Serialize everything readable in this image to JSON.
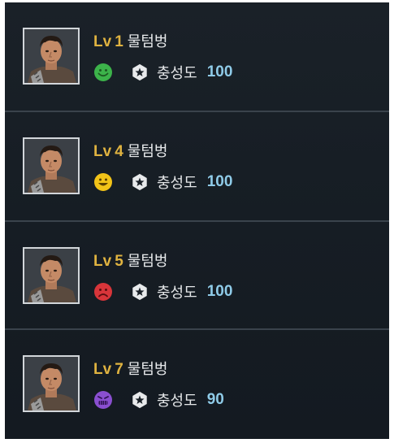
{
  "units": [
    {
      "lv_label": "Lv",
      "level": "1",
      "name": "물텀벙",
      "mood": "green-smile-icon",
      "mood_color": "#3cb34a",
      "loyalty_label": "충성도",
      "loyalty_value": "100"
    },
    {
      "lv_label": "Lv",
      "level": "4",
      "name": "물텀벙",
      "mood": "yellow-grin-icon",
      "mood_color": "#f2c318",
      "loyalty_label": "충성도",
      "loyalty_value": "100"
    },
    {
      "lv_label": "Lv",
      "level": "5",
      "name": "물텀벙",
      "mood": "red-frown-icon",
      "mood_color": "#d8353a",
      "loyalty_label": "충성도",
      "loyalty_value": "100"
    },
    {
      "lv_label": "Lv",
      "level": "7",
      "name": "물텀벙",
      "mood": "purple-upset-icon",
      "mood_color": "#8a4fd0",
      "loyalty_label": "충성도",
      "loyalty_value": "90"
    }
  ],
  "colors": {
    "level": "#e0b340",
    "loyalty_value": "#8fcbe8",
    "panel_bg": "#161d24",
    "divider": "#3a434c"
  }
}
